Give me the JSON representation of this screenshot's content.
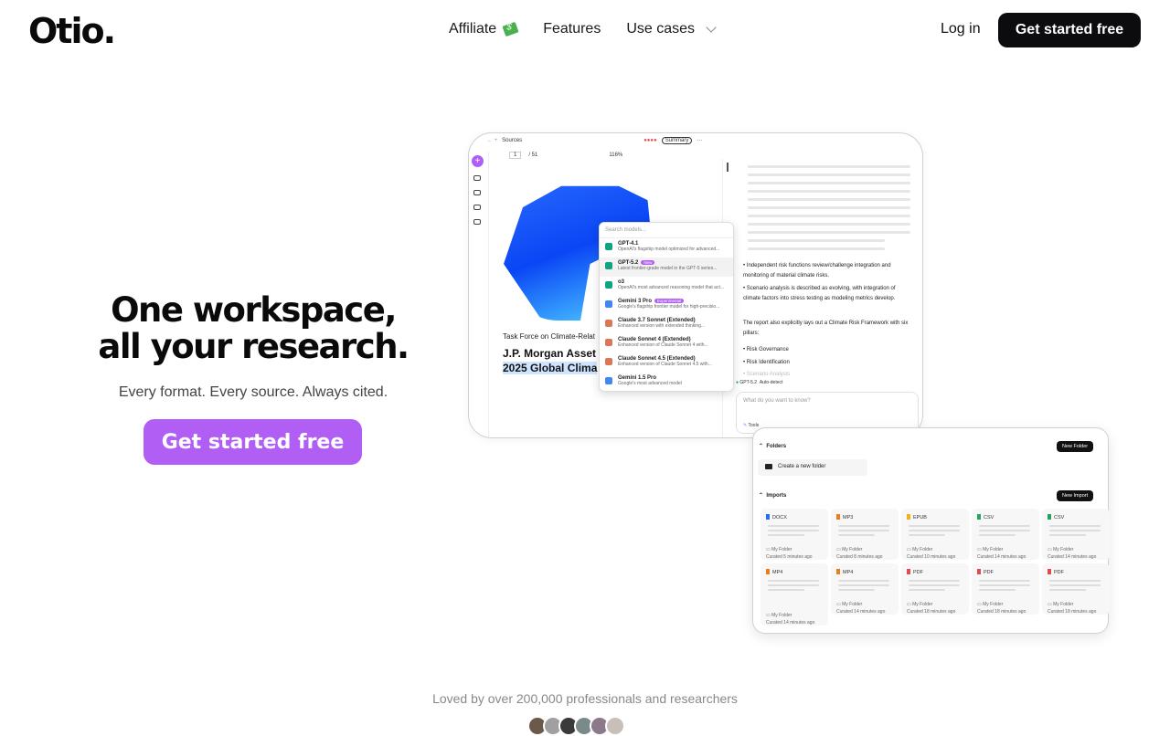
{
  "nav": {
    "logo": "Otio.",
    "links": [
      "Affiliate",
      "Features",
      "Use cases"
    ],
    "login": "Log in",
    "cta": "Get started free"
  },
  "hero": {
    "title_line1": "One workspace,",
    "title_line2": "all your research.",
    "subtitle": "Every format. Every source. Always cited.",
    "cta": "Get started free"
  },
  "social_proof": {
    "text": "Loved by over 200,000 professionals and researchers"
  },
  "app_preview": {
    "sources_tab": "Sources",
    "summary_btn": "Summary",
    "page": "1",
    "page_total": "/ 51",
    "zoom": "116%",
    "doc_heading": "Task Force on Climate-Relat",
    "doc_title_line1": "J.P. Morgan Asset",
    "doc_title_line2": "2025 Global Clima",
    "search_models_placeholder": "Search models...",
    "models": [
      {
        "name": "GPT-4.1",
        "desc": "OpenAI's flagship model optimized for advanced...",
        "color": "#10a37f"
      },
      {
        "name": "GPT-5.2",
        "badge": "New",
        "desc": "Latest frontier-grade model in the GPT-5 series...",
        "color": "#10a37f"
      },
      {
        "name": "o3",
        "desc": "OpenAI's most advanced reasoning model that act...",
        "color": "#10a37f"
      },
      {
        "name": "Gemini 3 Pro",
        "badge": "Experimental",
        "desc": "Google's flagship frontier model for high-precisio...",
        "color": "#4285f4"
      },
      {
        "name": "Claude 3.7 Sonnet (Extended)",
        "desc": "Enhanced version with extended thinking...",
        "color": "#d97757"
      },
      {
        "name": "Claude Sonnet 4 (Extended)",
        "desc": "Enhanced version of Claude Sonnet 4 with...",
        "color": "#d97757"
      },
      {
        "name": "Claude Sonnet 4.5 (Extended)",
        "desc": "Enhanced version of Claude Sonnet 4.5 with...",
        "color": "#d97757"
      },
      {
        "name": "Gemini 1.5 Pro",
        "desc": "Google's most advanced model",
        "color": "#4285f4"
      }
    ],
    "bullet1": "Independent risk functions review/challenge integration and monitoring of material climate risks.",
    "bullet2": "Scenario analysis is described as evolving, with integration of climate factors into stress testing as modeling metrics develop.",
    "pillars_intro": "The report also explicitly lays out a Climate Risk Framework with six pillars:",
    "pillar1": "Risk Governance",
    "pillar2": "Risk Identification",
    "pillar3": "Scenario Analysis",
    "chat_model": "GPT-5.2",
    "chat_mode": "Auto-detect",
    "chat_placeholder": "What do you want to know?",
    "tools": "Tools"
  },
  "library": {
    "folders_label": "Folders",
    "new_folder_btn": "New Folder",
    "create_folder": "Create a new folder",
    "imports_label": "Imports",
    "new_import_btn": "New Import",
    "cards": [
      {
        "type": "DOCX",
        "folder": "My Folder",
        "curated": "Curated 5 minutes ago",
        "color": "#2b6bf3"
      },
      {
        "type": "MP3",
        "folder": "My Folder",
        "curated": "Curated 8 minutes ago",
        "color": "#f07b1a"
      },
      {
        "type": "EPUB",
        "folder": "My Folder",
        "curated": "Curated 10 minutes ago",
        "color": "#f2b01e"
      },
      {
        "type": "CSV",
        "folder": "My Folder",
        "curated": "Curated 14 minutes ago",
        "color": "#22a55a"
      },
      {
        "type": "CSV",
        "folder": "My Folder",
        "curated": "Curated 14 minutes ago",
        "color": "#22a55a"
      },
      {
        "type": "MP4",
        "folder": "My Folder",
        "curated": "Curated 14 minutes ago",
        "color": "#f07b1a"
      },
      {
        "type": "MP4",
        "folder": "My Folder",
        "curated": "Curated 14 minutes ago",
        "color": "#f07b1a"
      },
      {
        "type": "PDF",
        "folder": "My Folder",
        "curated": "Curated 18 minutes ago",
        "color": "#e5484d"
      },
      {
        "type": "PDF",
        "folder": "My Folder",
        "curated": "Curated 18 minutes ago",
        "color": "#e5484d"
      },
      {
        "type": "PDF",
        "folder": "My Folder",
        "curated": "Curated 18 minutes ago",
        "color": "#e5484d"
      }
    ]
  },
  "colors": {
    "accent": "#b15ef5",
    "dark": "#0c0c0e"
  },
  "icons": [
    "money-icon",
    "chevron-down-icon",
    "plus-icon"
  ]
}
